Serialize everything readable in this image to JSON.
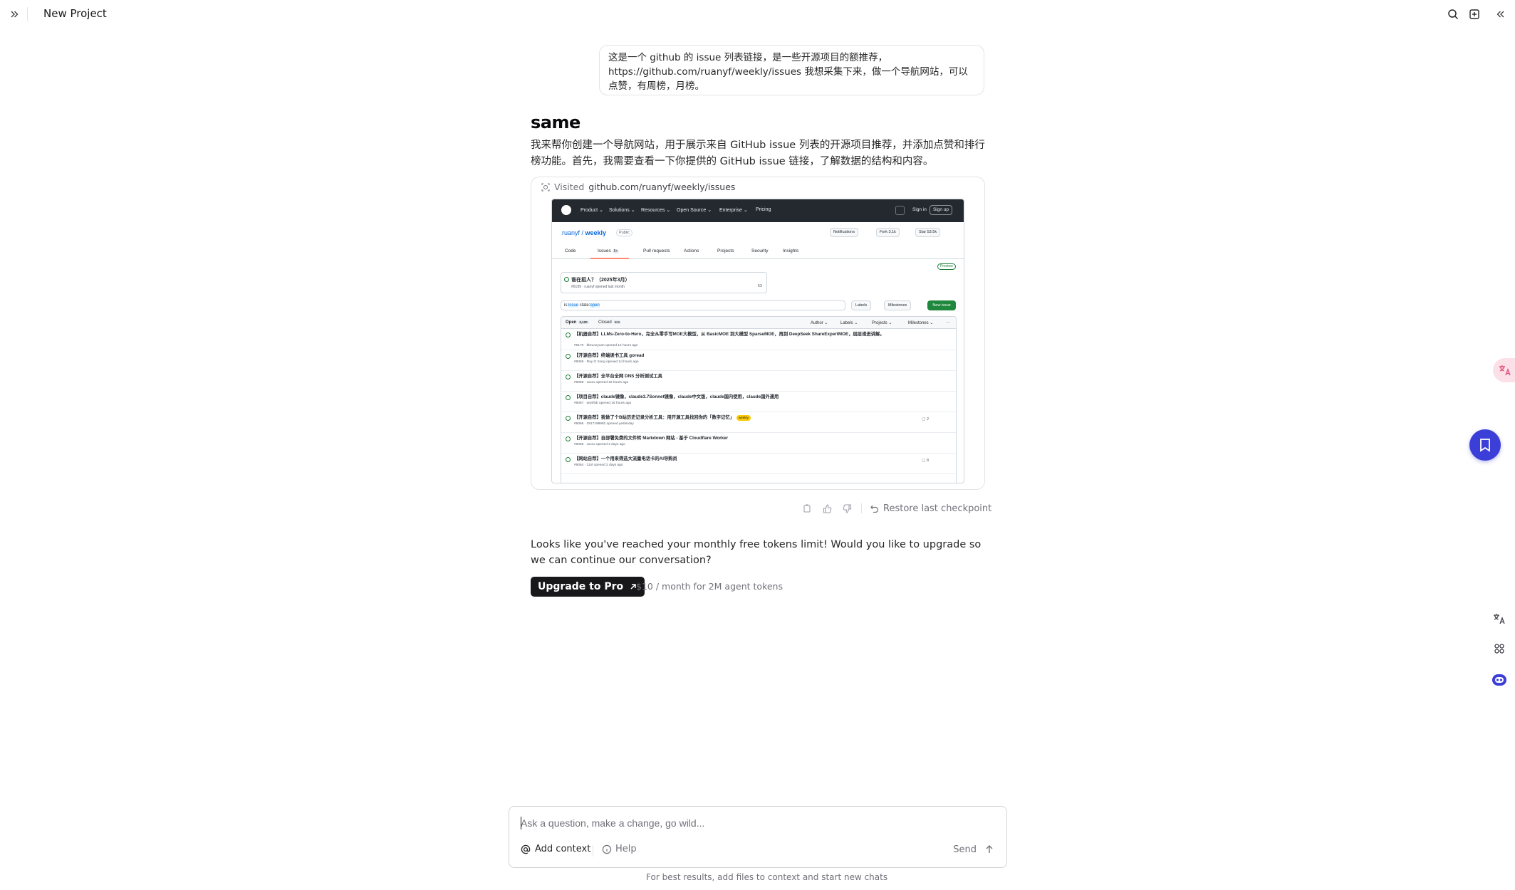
{
  "header": {
    "project_title": "New Project"
  },
  "user_message": "这是一个 github 的 issue 列表链接，是一些开源项目的额推荐，https://github.com/ruanyf/weekly/issues 我想采集下来，做一个导航网站，可以点赞，有周榜，月榜。",
  "assistant": {
    "name": "same",
    "intro": "我来帮你创建一个导航网站，用于展示来自 GitHub issue 列表的开源项目推荐，并添加点赞和排行榜功能。首先，我需要查看一下你提供的 GitHub issue 链接，了解数据的结构和内容。",
    "visit_label": "Visited",
    "visit_url": "github.com/ruanyf/weekly/issues"
  },
  "github": {
    "nav": [
      "Product ⌄",
      "Solutions ⌄",
      "Resources ⌄",
      "Open Source ⌄",
      "Enterprise ⌄",
      "Pricing"
    ],
    "sign_in": "Sign in",
    "sign_up": "Sign up",
    "owner": "ruanyf",
    "repo": "weekly",
    "visibility": "Public",
    "notifications": "Notifications",
    "fork": "Fork",
    "fork_count": "3.1k",
    "star": "Star",
    "star_count": "53.5k",
    "tabs": [
      "Code",
      "Issues",
      "Pull requests",
      "Actions",
      "Projects",
      "Security",
      "Insights"
    ],
    "issues_badge": "5+",
    "preview": "Preview",
    "pinned_title": "谁在招人？（2025年3月）",
    "pinned_meta": "#6199 · ruanyf opened last month",
    "pinned_comments": "53",
    "filter_prefix": "is:",
    "filter_issue": "issue",
    "filter_state": " state:",
    "filter_open": "open",
    "labels": "Labels",
    "milestones": "Milestones",
    "new_issue": "New issue",
    "open_label": "Open",
    "open_count": "3,120",
    "closed_label": "Closed",
    "closed_count": "906",
    "author": "Author ⌄",
    "labels_filter": "Labels ⌄",
    "projects": "Projects ⌄",
    "milestones_filter": "Milestones ⌄",
    "more": "···",
    "issues": [
      {
        "title": "【机器自荐】LLMs-Zero-to-Hero，完全从零手写MOE大模型，从 BasicMOE 到大模型 SparseMOE，再到 DeepSeek ShareExpertMOE，层层递进讲解。",
        "meta": "#6170 · bbruceyuan opened 14 hours ago",
        "comments": "",
        "label": ""
      },
      {
        "title": "【开源自荐】终端读书工具 goread",
        "meta": "#6069 · Roy G Song opened 1d hours ago",
        "comments": "",
        "label": ""
      },
      {
        "title": "【开源自荐】全平台全网 DNS 分析测试工具",
        "meta": "#6068 · xxxxx opened 15 hours ago",
        "comments": "",
        "label": ""
      },
      {
        "title": "【项目自荐】claude镜像，claude3.7Sonnet镜像，claude中文版，claude国内使用，claude国外通用",
        "meta": "#6067 · wsnflxb opened 16 hours ago",
        "comments": "",
        "label": ""
      },
      {
        "title": "【开源自荐】我做了个B站历史记录分析工具：用开源工具找回你的「数字记忆」",
        "meta": "#6066 · 2917198982 opened yesterday",
        "comments": "2",
        "label": "weekly"
      },
      {
        "title": "【开源自荐】自部署免费的文件转 Markdown 网站 - 基于 Cloudflare Worker",
        "meta": "#6065 · xxxxx opened 2 days ago",
        "comments": "",
        "label": ""
      },
      {
        "title": "【网站自荐】一个用来筛选大流量电话卡的AI导购员",
        "meta": "#6064 · 11ol opened 2 days ago",
        "comments": "8",
        "label": ""
      }
    ]
  },
  "actions": {
    "restore": "Restore last checkpoint"
  },
  "limit_message": "Looks like you've reached your monthly free tokens limit! Would you like to upgrade so we can continue our conversation?",
  "upgrade": {
    "button": "Upgrade to Pro",
    "price": "$10 / month for 2M agent tokens"
  },
  "composer": {
    "placeholder": "Ask a question, make a change, go wild...",
    "value": "",
    "add_context": "Add context",
    "help": "Help",
    "send": "Send",
    "hint": "For best results, add files to context and start new chats"
  },
  "icons": {
    "expand": "chevrons-right-icon",
    "search": "search-icon",
    "new_tab": "plus-square-icon",
    "collapse": "chevrons-left-icon",
    "bookmark": "bookmark-icon",
    "translate": "translate-icon",
    "apps": "apps-icon",
    "assistant": "robot-icon"
  },
  "colors": {
    "accent_fab": "#3b3fd8",
    "upgrade_button": "#18181b",
    "github_header": "#24292f",
    "github_green": "#1a7f37"
  }
}
